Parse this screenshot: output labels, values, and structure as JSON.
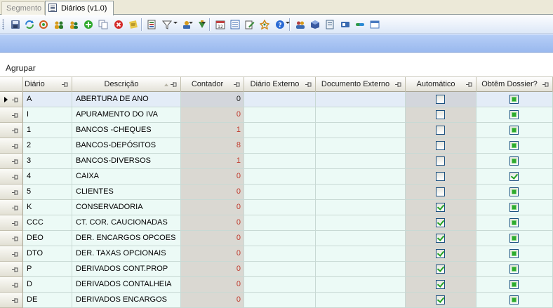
{
  "tabs": [
    {
      "label": "Segmento",
      "active": false
    },
    {
      "label": "Diários (v1.0)",
      "active": true
    }
  ],
  "toolbar": {
    "buttons": [
      {
        "icon": "save-icon",
        "color": "#5a6f9a"
      },
      {
        "icon": "refresh-icon",
        "color": "#2a7fd4"
      },
      {
        "icon": "sync-icon",
        "color": "#d05a1a"
      },
      {
        "icon": "group-users-icon",
        "color": "#d69a1a"
      },
      {
        "icon": "users-icon",
        "color": "#1f7a3a"
      },
      {
        "icon": "add-icon",
        "color": "#2ea82e"
      },
      {
        "icon": "copy-icon",
        "color": "#7a8aa8"
      },
      {
        "icon": "delete-icon",
        "color": "#d42a2a"
      },
      {
        "icon": "note-icon",
        "color": "#e8c84a"
      },
      {
        "icon": "export-icon",
        "color": "#4a8a4a"
      },
      {
        "icon": "filter-icon",
        "color": "#555555"
      },
      {
        "icon": "print-icon",
        "color": "#3a6ab0"
      },
      {
        "icon": "tools-icon",
        "color": "#3a8a3a"
      },
      {
        "icon": "calendar-icon",
        "color": "#c04040"
      },
      {
        "icon": "list-icon",
        "color": "#3a6ab0"
      },
      {
        "icon": "edit-icon",
        "color": "#3a8a3a"
      },
      {
        "icon": "wizard-icon",
        "color": "#d08a1a"
      },
      {
        "icon": "help-icon",
        "color": "#2a6ad4"
      },
      {
        "icon": "contacts-icon",
        "color": "#b04040"
      },
      {
        "icon": "box-icon",
        "color": "#3a5aa0"
      },
      {
        "icon": "document-icon",
        "color": "#4a6a8a"
      },
      {
        "icon": "card-icon",
        "color": "#3a6ab0"
      },
      {
        "icon": "link-icon",
        "color": "#2a8ad4"
      },
      {
        "icon": "window-icon",
        "color": "#4a7ac0"
      }
    ]
  },
  "group_area": {
    "label": "Agrupar"
  },
  "columns": [
    {
      "label": "Diário",
      "align": "left"
    },
    {
      "label": "Descrição",
      "align": "center"
    },
    {
      "label": "Contador",
      "align": "center"
    },
    {
      "label": "Diário Externo",
      "align": "center"
    },
    {
      "label": "Documento Externo",
      "align": "center"
    },
    {
      "label": "Automático",
      "align": "center"
    },
    {
      "label": "Obtêm Dossier?",
      "align": "center"
    }
  ],
  "rows": [
    {
      "diario": "A",
      "descricao": "ABERTURA DE ANO",
      "contador": "0",
      "contador_color": "dark",
      "externo": "",
      "documento": "",
      "automatico": false,
      "dossier": "filled"
    },
    {
      "diario": "I",
      "descricao": "APURAMENTO DO IVA",
      "contador": "0",
      "contador_color": "red",
      "externo": "",
      "documento": "",
      "automatico": false,
      "dossier": "filled"
    },
    {
      "diario": "1",
      "descricao": "BANCOS -CHEQUES",
      "contador": "1",
      "contador_color": "red",
      "externo": "",
      "documento": "",
      "automatico": false,
      "dossier": "filled"
    },
    {
      "diario": "2",
      "descricao": "BANCOS-DEPÓSITOS",
      "contador": "8",
      "contador_color": "red",
      "externo": "",
      "documento": "",
      "automatico": false,
      "dossier": "filled"
    },
    {
      "diario": "3",
      "descricao": "BANCOS-DIVERSOS",
      "contador": "1",
      "contador_color": "red",
      "externo": "",
      "documento": "",
      "automatico": false,
      "dossier": "filled"
    },
    {
      "diario": "4",
      "descricao": "CAIXA",
      "contador": "0",
      "contador_color": "red",
      "externo": "",
      "documento": "",
      "automatico": false,
      "dossier": "checked"
    },
    {
      "diario": "5",
      "descricao": "CLIENTES",
      "contador": "0",
      "contador_color": "red",
      "externo": "",
      "documento": "",
      "automatico": false,
      "dossier": "filled"
    },
    {
      "diario": "K",
      "descricao": "CONSERVADORIA",
      "contador": "0",
      "contador_color": "red",
      "externo": "",
      "documento": "",
      "automatico": true,
      "dossier": "filled"
    },
    {
      "diario": "CCC",
      "descricao": "CT. COR. CAUCIONADAS",
      "contador": "0",
      "contador_color": "red",
      "externo": "",
      "documento": "",
      "automatico": true,
      "dossier": "filled"
    },
    {
      "diario": "DEO",
      "descricao": "DER. ENCARGOS OPCOES",
      "contador": "0",
      "contador_color": "red",
      "externo": "",
      "documento": "",
      "automatico": true,
      "dossier": "filled"
    },
    {
      "diario": "DTO",
      "descricao": "DER. TAXAS OPCIONAIS",
      "contador": "0",
      "contador_color": "red",
      "externo": "",
      "documento": "",
      "automatico": true,
      "dossier": "filled"
    },
    {
      "diario": "P",
      "descricao": "DERIVADOS CONT.PROP",
      "contador": "0",
      "contador_color": "red",
      "externo": "",
      "documento": "",
      "automatico": true,
      "dossier": "filled"
    },
    {
      "diario": "D",
      "descricao": "DERIVADOS CONTALHEIA",
      "contador": "0",
      "contador_color": "red",
      "externo": "",
      "documento": "",
      "automatico": true,
      "dossier": "filled"
    },
    {
      "diario": "DE",
      "descricao": "DERIVADOS ENCARGOS",
      "contador": "0",
      "contador_color": "red",
      "externo": "",
      "documento": "",
      "automatico": true,
      "dossier": "filled"
    }
  ]
}
